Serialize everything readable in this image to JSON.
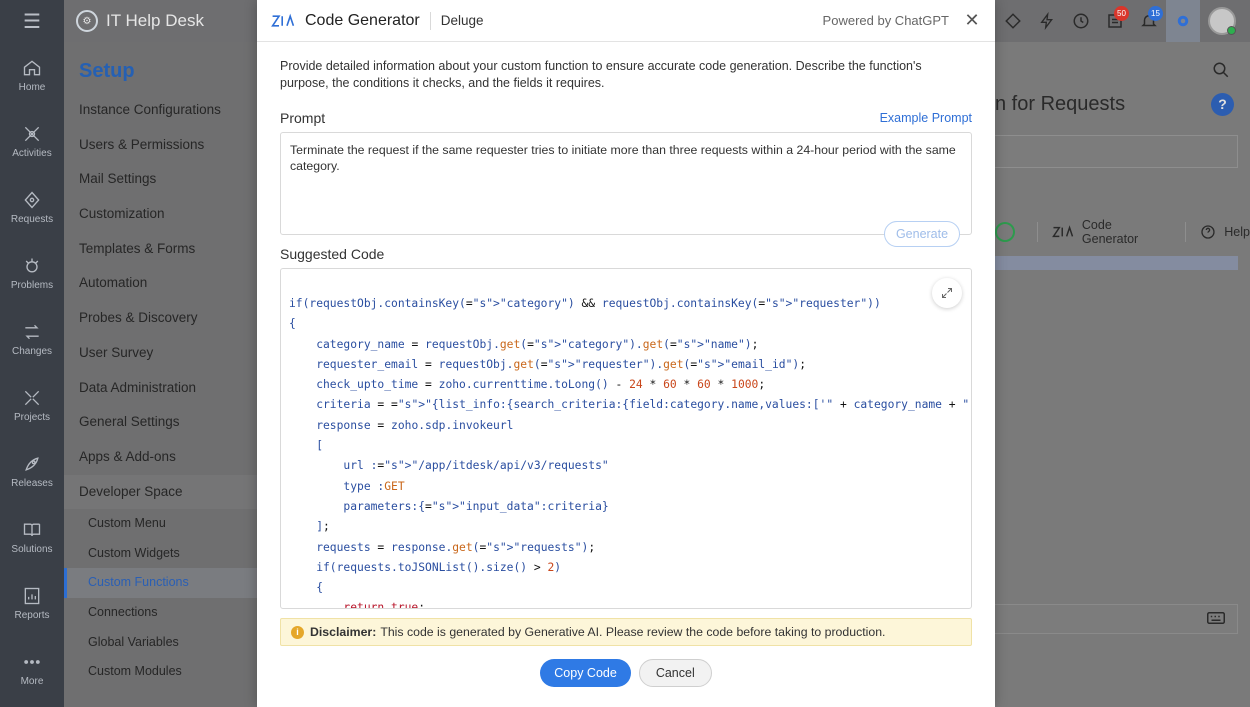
{
  "app": {
    "name": "IT Help Desk"
  },
  "rail": {
    "items": [
      {
        "label": "Home",
        "icon": "home-icon"
      },
      {
        "label": "Activities",
        "icon": "activities-icon"
      },
      {
        "label": "Requests",
        "icon": "requests-icon"
      },
      {
        "label": "Problems",
        "icon": "problems-icon"
      },
      {
        "label": "Changes",
        "icon": "changes-icon"
      },
      {
        "label": "Projects",
        "icon": "projects-icon"
      },
      {
        "label": "Releases",
        "icon": "releases-icon"
      },
      {
        "label": "Solutions",
        "icon": "solutions-icon"
      },
      {
        "label": "Reports",
        "icon": "reports-icon"
      },
      {
        "label": "More",
        "icon": "more-icon"
      }
    ]
  },
  "topbar": {
    "badges": {
      "tasks": "50",
      "notifications": "15"
    },
    "badge_colors": {
      "tasks": "#d9362b",
      "notifications": "#2f6fd6"
    }
  },
  "setup": {
    "title": "Setup",
    "items": [
      "Instance Configurations",
      "Users & Permissions",
      "Mail Settings",
      "Customization",
      "Templates & Forms",
      "Automation",
      "Probes & Discovery",
      "User Survey",
      "Data Administration",
      "General Settings",
      "Apps & Add-ons"
    ],
    "section": "Developer Space",
    "sub_items": [
      "Custom Menu",
      "Custom Widgets",
      "Custom Functions",
      "Connections",
      "Global Variables",
      "Custom Modules"
    ],
    "active_sub": "Custom Functions"
  },
  "main": {
    "title_fragment": "n for Requests",
    "toolbar": {
      "code_generator": "Code Generator",
      "help": "Help"
    }
  },
  "modal": {
    "title": "Code Generator",
    "language": "Deluge",
    "powered_by": "Powered by ChatGPT",
    "description": "Provide detailed information about your custom function to ensure accurate code generation. Describe the function's purpose, the conditions it checks, and the fields it requires.",
    "prompt_label": "Prompt",
    "example_link": "Example Prompt",
    "prompt_text": "Terminate the request if the same requester tries to initiate more than three requests within a 24-hour period with the same category.",
    "generate_label": "Generate",
    "suggested_label": "Suggested Code",
    "code_lines": [
      "if(requestObj.containsKey(\"category\") && requestObj.containsKey(\"requester\"))",
      "{",
      "    category_name = requestObj.get(\"category\").get(\"name\");",
      "    requester_email = requestObj.get(\"requester\").get(\"email_id\");",
      "    check_upto_time = zoho.currenttime.toLong() - 24 * 60 * 60 * 1000;",
      "    criteria = \"{list_info:{search_criteria:{field:category.name,values:['\" + category_name + \"'],condition:i",
      "    response = zoho.sdp.invokeurl",
      "    [",
      "        url :\"/app/itdesk/api/v3/requests\"",
      "        type :GET",
      "        parameters:{\"input_data\":criteria}",
      "    ];",
      "    requests = response.get(\"requests\");",
      "    if(requests.toJSONList().size() > 2)",
      "    {",
      "        return true;"
    ],
    "disclaimer_label": "Disclaimer:",
    "disclaimer_text": "This code is generated by Generative AI. Please review the code before taking to production.",
    "copy_label": "Copy Code",
    "cancel_label": "Cancel"
  }
}
